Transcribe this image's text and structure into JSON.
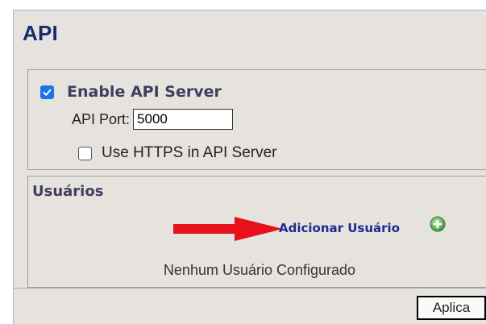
{
  "panel": {
    "title": "API"
  },
  "api_server": {
    "enable_label": "Enable API Server",
    "enabled": true,
    "port_label": "API Port:",
    "port_value": "5000",
    "https_label": "Use HTTPS in API Server",
    "https_enabled": false
  },
  "users": {
    "heading": "Usuários",
    "add_user_label": "Adicionar Usuário",
    "empty_message": "Nenhum Usuário Configurado"
  },
  "footer": {
    "apply_label": "Aplica"
  },
  "colors": {
    "panel_bg": "#e6e3de",
    "title": "#1b2a6e",
    "link": "#1d2b8f",
    "checkbox_checked": "#1a73e8",
    "arrow": "#e8101a",
    "plus_icon": "#4caf50"
  },
  "icons": {
    "enable_checkbox": "checkbox-checked-icon",
    "https_checkbox": "checkbox-unchecked-icon",
    "add_user": "plus-circle-icon",
    "annotation": "red-arrow-icon"
  }
}
